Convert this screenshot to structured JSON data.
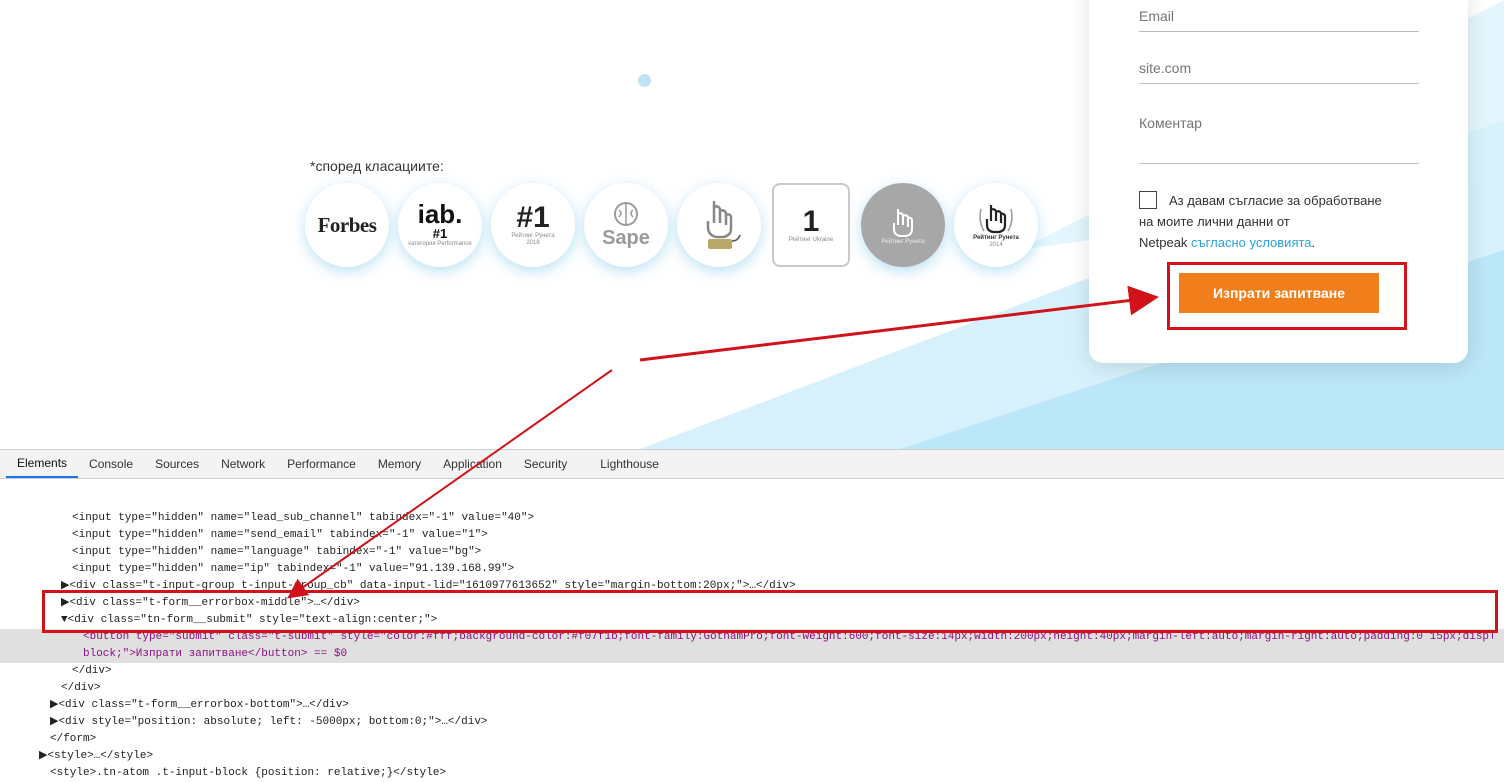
{
  "colors": {
    "accent_orange": "#f07f1b",
    "link_blue": "#29a3d6",
    "highlight_red": "#d0121b",
    "bg_light_blue": "#c8ecfa"
  },
  "hero": {
    "ratings_caption": "*според класациите:",
    "badges": [
      {
        "icon": "forbes-logo-icon",
        "text": "Forbes"
      },
      {
        "icon": "iab-logo-icon",
        "text": "iab.",
        "sub": "#1",
        "small": "категория Performance"
      },
      {
        "icon": "runeta-rating-2018-icon",
        "text": "#1",
        "small": "Рейтинг Рунета",
        "year": "2018"
      },
      {
        "icon": "sape-logo-icon",
        "text": "Sape"
      },
      {
        "icon": "hand-award-icon"
      },
      {
        "icon": "ukraine-rating-badge-icon",
        "text": "1",
        "small": "Рейтинг Ukraine"
      },
      {
        "icon": "runeta-rating-gray-icon",
        "small": "Рейтинг Рунета"
      },
      {
        "icon": "runeta-rating-2014-icon",
        "small": "Рейтинг Рунета",
        "year": "2014"
      }
    ]
  },
  "form": {
    "email_placeholder": "Email",
    "site_placeholder": "site.com",
    "comment_placeholder": "Коментар",
    "consent_line1": "Аз давам съгласие за обработване",
    "consent_line2": "на моите лични данни от",
    "consent_line3": "Netpeak ",
    "consent_link": "съгласно условията",
    "consent_end": ".",
    "submit_label": "Изпрати запитване"
  },
  "devtools": {
    "tabs": [
      "Elements",
      "Console",
      "Sources",
      "Network",
      "Performance",
      "Memory",
      "Application",
      "Security",
      "Lighthouse"
    ],
    "active_tab": "Elements",
    "lines": [
      "<input type=\"hidden\" name=\"lead_sub_channel\" tabindex=\"-1\" value=\"40\">",
      "<input type=\"hidden\" name=\"send_email\" tabindex=\"-1\" value=\"1\">",
      "<input type=\"hidden\" name=\"language\" tabindex=\"-1\" value=\"bg\">",
      "<input type=\"hidden\" name=\"ip\" tabindex=\"-1\" value=\"91.139.168.99\">",
      "▶<div class=\"t-input-group t-input-group_cb\" data-input-lid=\"1610977613652\" style=\"margin-bottom:20px;\">…</div>",
      "▶<div class=\"t-form__errorbox-middle\">…</div>",
      "▼<div class=\"tn-form__submit\" style=\"text-align:center;\">",
      "<button type=\"submit\" class=\"t-submit\" style=\"color:#fff;background-color:#f07f1b;font-family:GothamPro;font-weight:600;font-size:14px;width:200px;height:40px;margin-left:auto;margin-right:auto;padding:0 15px;display:",
      "block;\">Изпрати запитване</button> == $0",
      "</div>",
      "</div>",
      "▶<div class=\"t-form__errorbox-bottom\">…</div>",
      "▶<div style=\"position: absolute; left: -5000px; bottom:0;\">…</div>",
      "</form>",
      "▶<style>…</style>",
      "<style>.tn-atom .t-input-block {position: relative;}</style>"
    ]
  }
}
